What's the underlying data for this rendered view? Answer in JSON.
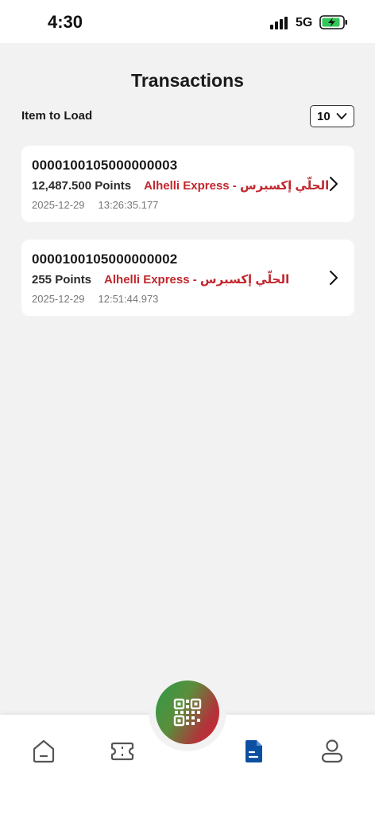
{
  "status_bar": {
    "time": "4:30",
    "network": "5G",
    "battery_color": "#34c759"
  },
  "page": {
    "title": "Transactions",
    "items_to_load_label": "Item to Load",
    "items_to_load_value": "10"
  },
  "transactions": [
    {
      "id": "0000100105000000003",
      "points": "12,487.500 Points",
      "merchant": "Alhelli Express - الحلّي إكسبرس",
      "date": "2025-12-29",
      "time": "13:26:35.177"
    },
    {
      "id": "0000100105000000002",
      "points": "255 Points",
      "merchant": "Alhelli Express - الحلّي إكسبرس",
      "date": "2025-12-29",
      "time": "12:51:44.973"
    }
  ],
  "bottom_nav": {
    "items": [
      {
        "icon": "home-icon",
        "active": false
      },
      {
        "icon": "ticket-icon",
        "active": false
      },
      {
        "icon": "scan-qr-icon",
        "active": false
      },
      {
        "icon": "document-icon",
        "active": true
      },
      {
        "icon": "profile-icon",
        "active": false
      }
    ],
    "active_color": "#0b4fa0",
    "inactive_color": "#555555"
  },
  "colors": {
    "merchant_red": "#c1272d",
    "background": "#f2f2f2",
    "card": "#ffffff"
  }
}
